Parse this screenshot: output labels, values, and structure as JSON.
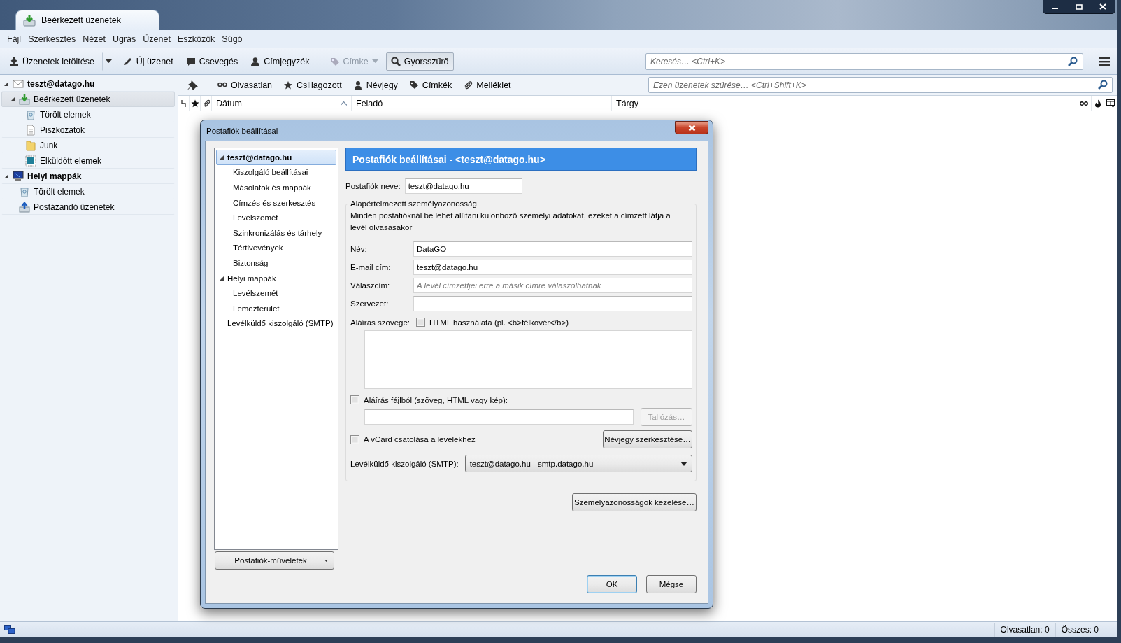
{
  "window": {
    "tab_title": "Beérkezett üzenetek"
  },
  "menu": [
    "Fájl",
    "Szerkesztés",
    "Nézet",
    "Ugrás",
    "Üzenet",
    "Eszközök",
    "Súgó"
  ],
  "toolbar": {
    "buttons": [
      {
        "label": "Üzenetek letöltése",
        "kind": "split",
        "disabled": false,
        "pressed": false
      },
      {
        "label": "Új üzenet",
        "kind": "plain",
        "disabled": false,
        "pressed": false
      },
      {
        "label": "Csevegés",
        "kind": "plain",
        "disabled": false,
        "pressed": false
      },
      {
        "label": "Címjegyzék",
        "kind": "plain",
        "disabled": false,
        "pressed": false
      },
      {
        "label": "Címke",
        "kind": "menu",
        "disabled": true,
        "pressed": false
      },
      {
        "label": "Gyorsszűrő",
        "kind": "plain",
        "disabled": false,
        "pressed": true
      }
    ],
    "search": {
      "placeholder": "Keresés… <Ctrl+K>"
    }
  },
  "folders": [
    {
      "label": "teszt@datago.hu",
      "kind": "account",
      "selected": false,
      "expanded": true,
      "children": [
        {
          "label": "Beérkezett üzenetek",
          "kind": "inbox",
          "selected": true,
          "expanded": true,
          "children": [
            {
              "label": "Törölt elemek",
              "kind": "trash",
              "selected": false
            },
            {
              "label": "Piszkozatok",
              "kind": "drafts",
              "selected": false
            },
            {
              "label": "Junk",
              "kind": "junk",
              "selected": false
            },
            {
              "label": "Elküldött elemek",
              "kind": "sent",
              "selected": false
            }
          ]
        }
      ]
    },
    {
      "label": "Helyi mappák",
      "kind": "local",
      "selected": false,
      "expanded": true,
      "children": [
        {
          "label": "Törölt elemek",
          "kind": "trash",
          "selected": false
        },
        {
          "label": "Postázandó üzenetek",
          "kind": "outbox",
          "selected": false
        }
      ]
    }
  ],
  "quick_filter": {
    "buttons": [
      "Olvasatlan",
      "Csillagozott",
      "Névjegy",
      "Címkék",
      "Melléklet"
    ],
    "placeholder": "Ezen üzenetek szűrése… <Ctrl+Shift+K>"
  },
  "message_list": {
    "columns": [
      {
        "label": "Dátum",
        "sorted": true
      },
      {
        "label": "Feladó",
        "sorted": false
      },
      {
        "label": "Tárgy",
        "sorted": false
      }
    ]
  },
  "dialog": {
    "title": "Postafiók beállításai",
    "tree": [
      {
        "label": "teszt@datago.hu",
        "selected": true,
        "expanded": true,
        "children": [
          {
            "label": "Kiszolgáló beállításai",
            "selected": false
          },
          {
            "label": "Másolatok és mappák",
            "selected": false
          },
          {
            "label": "Címzés és szerkesztés",
            "selected": false
          },
          {
            "label": "Levélszemét",
            "selected": false
          },
          {
            "label": "Szinkronizálás és tárhely",
            "selected": false
          },
          {
            "label": "Tértivevények",
            "selected": false
          },
          {
            "label": "Biztonság",
            "selected": false
          }
        ]
      },
      {
        "label": "Helyi mappák",
        "selected": false,
        "expanded": true,
        "children": [
          {
            "label": "Levélszemét",
            "selected": false
          },
          {
            "label": "Lemezterület",
            "selected": false
          }
        ]
      },
      {
        "label": "Levélküldő kiszolgáló (SMTP)",
        "selected": false
      }
    ],
    "account_actions": "Postafiók-műveletek",
    "heading": "Postafiók beállításai - <teszt@datago.hu>",
    "account_name": {
      "label": "Postafiók neve:",
      "value": "teszt@datago.hu"
    },
    "identity": {
      "legend": "Alapértelmezett személyazonosság",
      "description": "Minden postafióknál be lehet állítani különböző személyi adatokat, ezeket a címzett látja a levél olvasásakor",
      "fields": [
        {
          "label": "Név:",
          "value": "DataGO"
        },
        {
          "label": "E-mail cím:",
          "value": "teszt@datago.hu"
        },
        {
          "label": "Válaszcím:",
          "placeholder": "A levél címzettjei erre a másik címre válaszolhatnak"
        },
        {
          "label": "Szervezet:"
        }
      ]
    },
    "signature": {
      "label": "Aláírás szövege:",
      "html_label": "HTML használata (pl. <b>félkövér</b>)",
      "html_checked": false
    },
    "signature_file": {
      "label": "Aláírás fájlból (szöveg, HTML vagy kép):",
      "checked": false,
      "browse_label": "Tallózás…",
      "browse_disabled": true
    },
    "vcard": {
      "label": "A vCard csatolása a levelekhez",
      "checked": false,
      "edit_label": "Névjegy szerkesztése…"
    },
    "smtp": {
      "label": "Levélküldő kiszolgáló (SMTP):",
      "value": "teszt@datago.hu - smtp.datago.hu"
    },
    "manage_label": "Személyazonosságok kezelése…",
    "buttons": [
      {
        "label": "OK",
        "default": true
      },
      {
        "label": "Mégse",
        "default": false
      }
    ]
  },
  "status_bar": {
    "unread": "Olvasatlan: 0",
    "total": "Összes: 0"
  }
}
